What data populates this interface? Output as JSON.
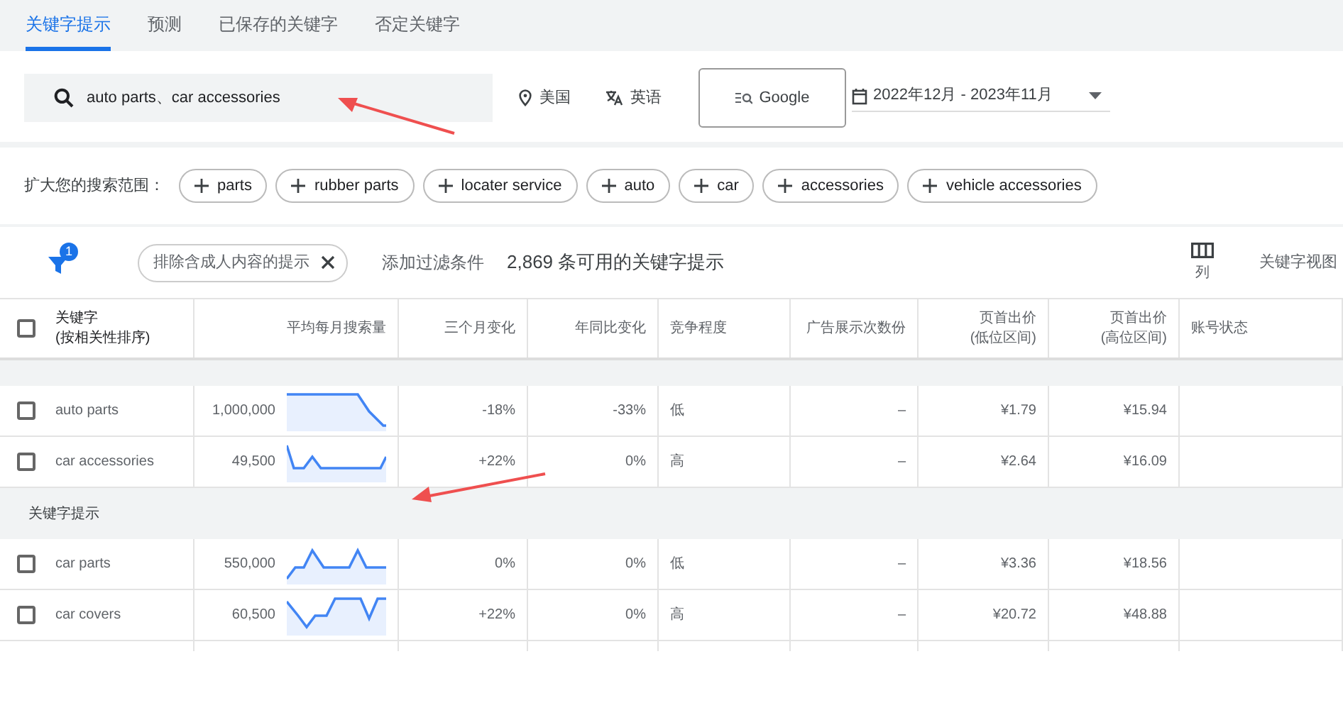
{
  "tabs": [
    {
      "label": "关键字提示",
      "selected": true
    },
    {
      "label": "预测",
      "selected": false
    },
    {
      "label": "已保存的关键字",
      "selected": false
    },
    {
      "label": "否定关键字",
      "selected": false
    }
  ],
  "search": {
    "value": "auto parts、car accessories"
  },
  "location": "美国",
  "language": "英语",
  "network": "Google",
  "date_range": "2022年12月 - 2023年11月",
  "expand": {
    "label": "扩大您的搜索范围：",
    "chips": [
      "parts",
      "rubber parts",
      "locater service",
      "auto",
      "car",
      "accessories",
      "vehicle accessories"
    ]
  },
  "filter": {
    "badge": "1",
    "chip": "排除含成人内容的提示",
    "add_filter": "添加过滤条件",
    "count": "2,869 条可用的关键字提示",
    "columns_button": "列",
    "view_button": "关键字视图"
  },
  "table": {
    "select_all_checked": false,
    "columns": [
      "关键字\n(按相关性排序)",
      "平均每月搜索量",
      "三个月变化",
      "年同比变化",
      "竞争程度",
      "广告展示次数份",
      "页首出价\n(低位区间)",
      "页首出价\n(高位区间)",
      "账号状态"
    ],
    "sections": [
      {
        "rows": [
          {
            "checked": false,
            "keyword": "auto parts",
            "volume": "1,000,000",
            "three_month": "-18%",
            "yoy": "-33%",
            "competition": "低",
            "ad_share": "–",
            "bid_low": "¥1.79",
            "bid_high": "¥15.94"
          },
          {
            "checked": false,
            "keyword": "car accessories",
            "volume": "49,500",
            "three_month": "+22%",
            "yoy": "0%",
            "competition": "高",
            "ad_share": "–",
            "bid_low": "¥2.64",
            "bid_high": "¥16.09"
          }
        ]
      },
      {
        "title": "关键字提示",
        "rows": [
          {
            "checked": false,
            "keyword": "car parts",
            "volume": "550,000",
            "three_month": "0%",
            "yoy": "0%",
            "competition": "低",
            "ad_share": "–",
            "bid_low": "¥3.36",
            "bid_high": "¥18.56"
          },
          {
            "checked": false,
            "keyword": "car covers",
            "volume": "60,500",
            "three_month": "+22%",
            "yoy": "0%",
            "competition": "高",
            "ad_share": "–",
            "bid_low": "¥20.72",
            "bid_high": "¥48.88"
          }
        ]
      }
    ]
  }
}
